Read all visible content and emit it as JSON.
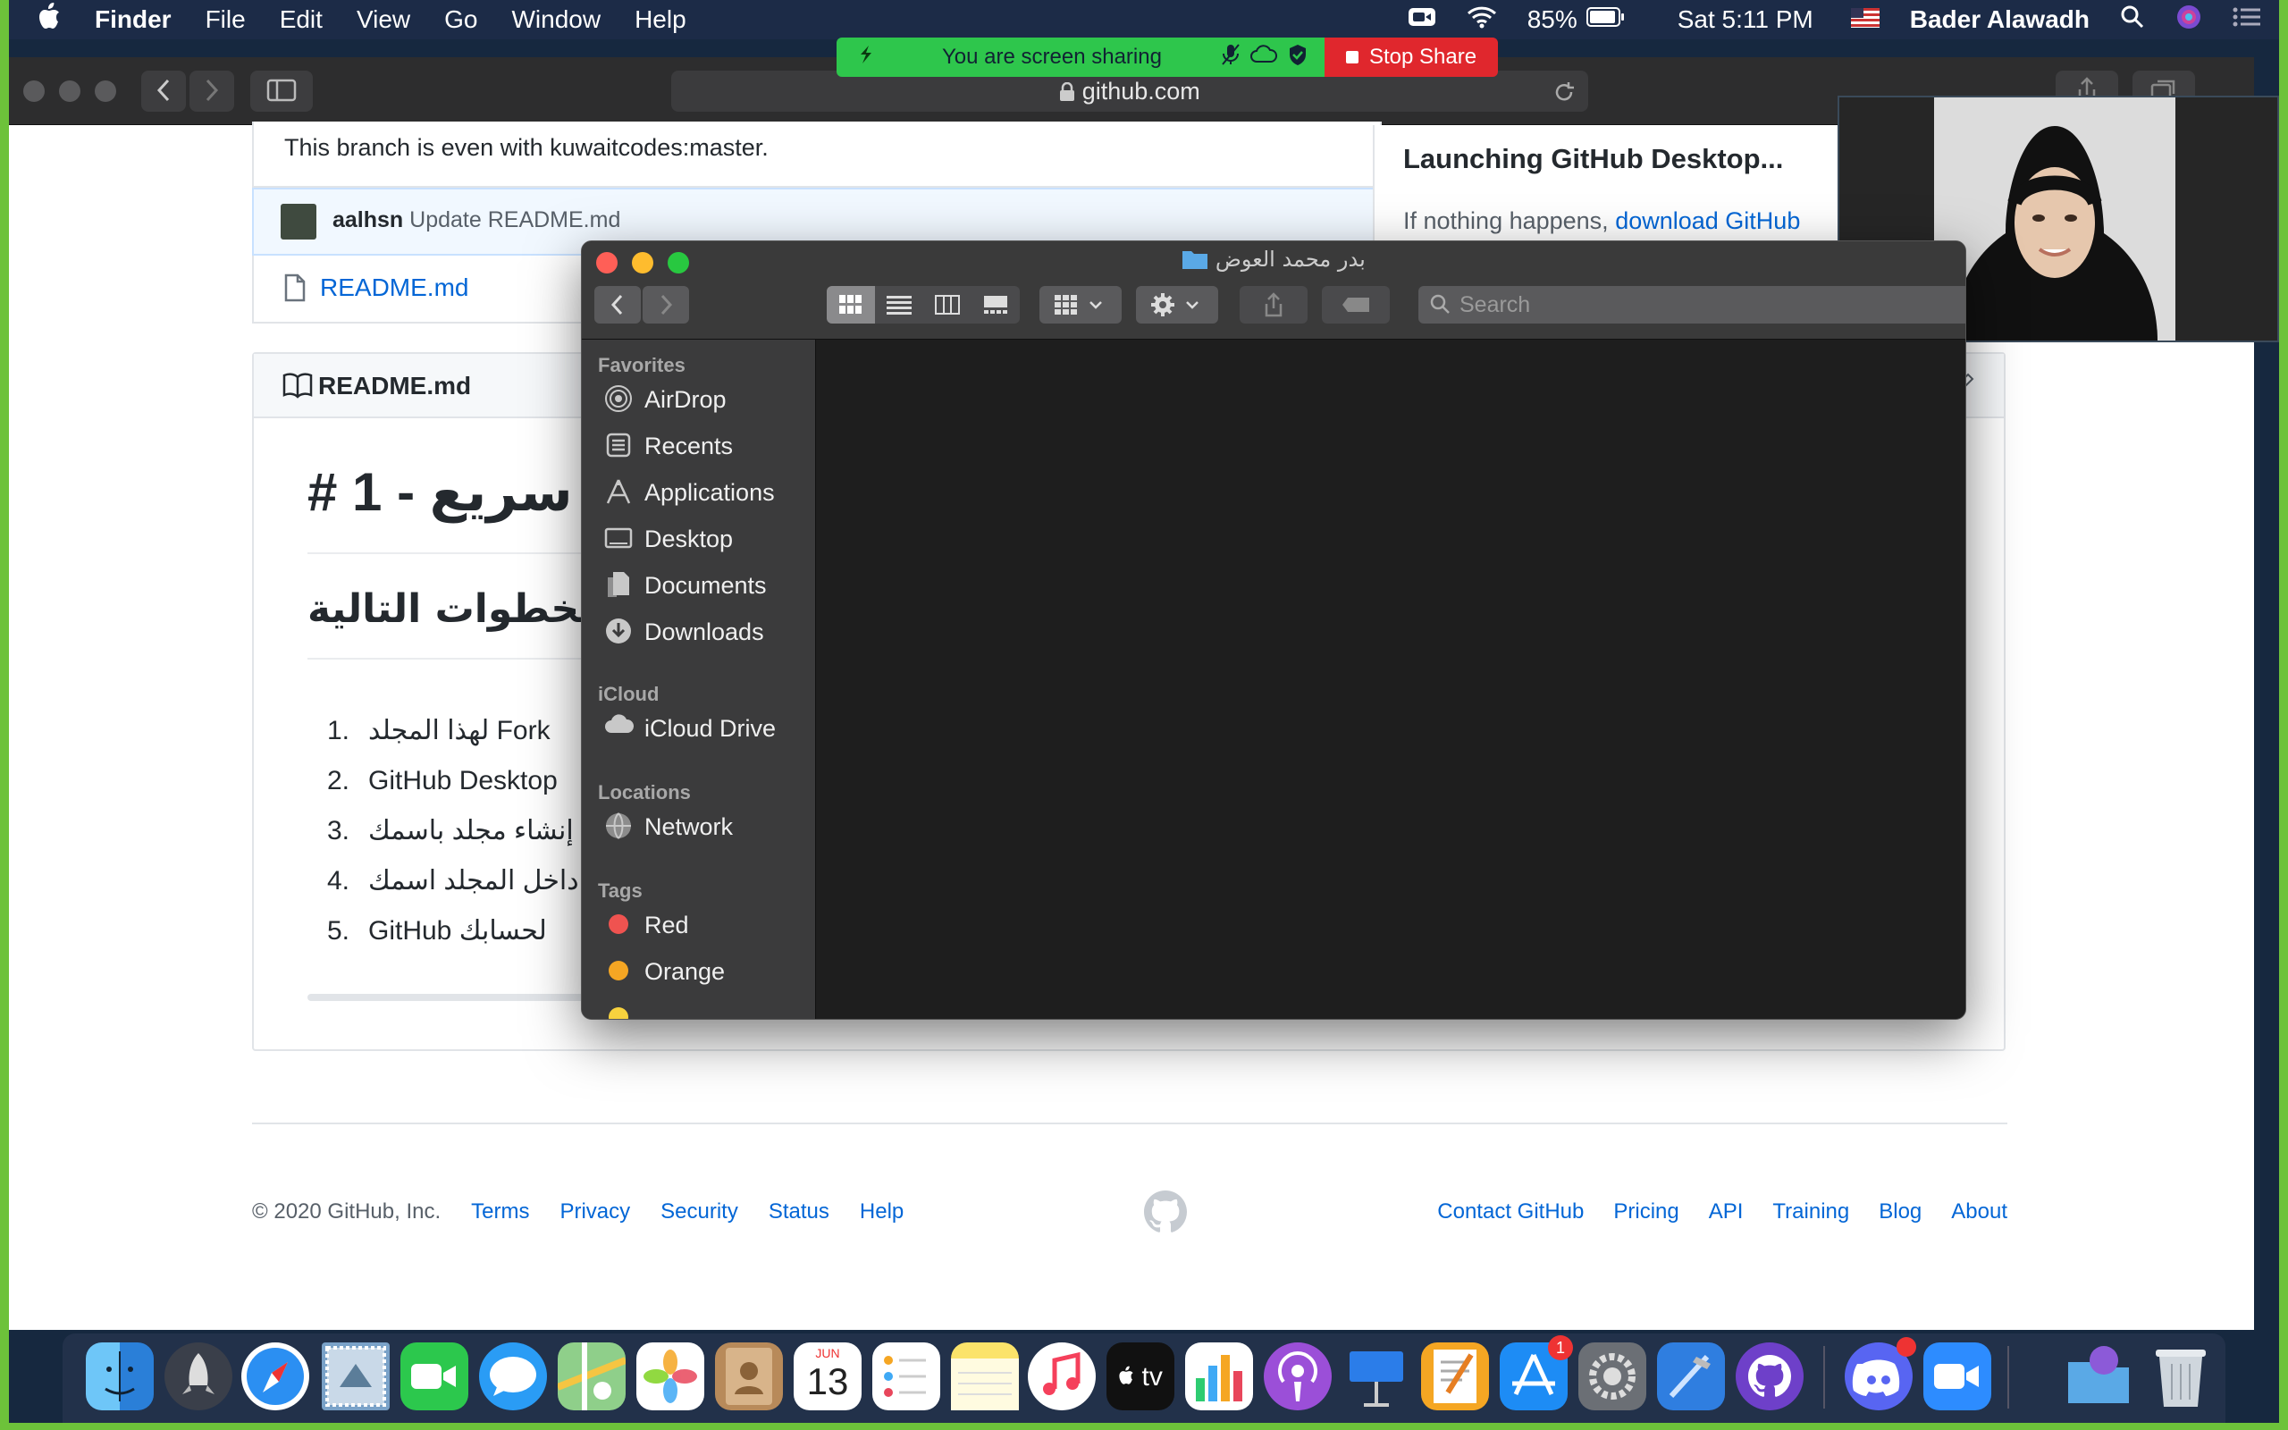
{
  "menubar": {
    "apple": "",
    "app": "Finder",
    "items": [
      "File",
      "Edit",
      "View",
      "Go",
      "Window",
      "Help"
    ],
    "battery": "85%",
    "clock": "Sat 5:11 PM",
    "user": "Bader Alawadh"
  },
  "screen_share": {
    "status": "You are screen sharing",
    "stop": "Stop Share"
  },
  "browser": {
    "url": "github.com"
  },
  "github": {
    "branch_msg": "This branch is even with kuwaitcodes:master.",
    "commit_user": "aalhsn",
    "commit_msg": "Update README.md",
    "file": "README.md",
    "readme_header": "README.md",
    "launch_title": "Launching GitHub Desktop...",
    "launch_text": "If nothing happens,",
    "launch_link": "download GitHub",
    "h1_prefix": "# 1 -",
    "h1_visible": "سريع",
    "h2_visible": "الخطوات التالية",
    "list": [
      {
        "num": "1.",
        "text": "لهذا المجلد Fork"
      },
      {
        "num": "2.",
        "text": "GitHub Desktop"
      },
      {
        "num": "3.",
        "text": "إنشاء مجلد باسمك"
      },
      {
        "num": "4.",
        "text": "داخل المجلد اسمك"
      },
      {
        "num": "5.",
        "text": "GitHub لحسابك"
      }
    ],
    "footer_copyright": "© 2020 GitHub, Inc.",
    "footer_left": [
      "Terms",
      "Privacy",
      "Security",
      "Status",
      "Help"
    ],
    "footer_right": [
      "Contact GitHub",
      "Pricing",
      "API",
      "Training",
      "Blog",
      "About"
    ]
  },
  "finder": {
    "title": "بدر محمد العوض",
    "search_placeholder": "Search",
    "favorites_label": "Favorites",
    "favorites": [
      "AirDrop",
      "Recents",
      "Applications",
      "Desktop",
      "Documents",
      "Downloads"
    ],
    "icloud_label": "iCloud",
    "icloud": [
      "iCloud Drive"
    ],
    "locations_label": "Locations",
    "locations": [
      "Network"
    ],
    "tags_label": "Tags",
    "tags": [
      {
        "name": "Red",
        "color": "#ef5350"
      },
      {
        "name": "Orange",
        "color": "#f5a623"
      }
    ]
  },
  "dock": {
    "calendar_month": "JUN",
    "calendar_day": "13",
    "appstore_badge": "1",
    "tv_label": "tv"
  }
}
